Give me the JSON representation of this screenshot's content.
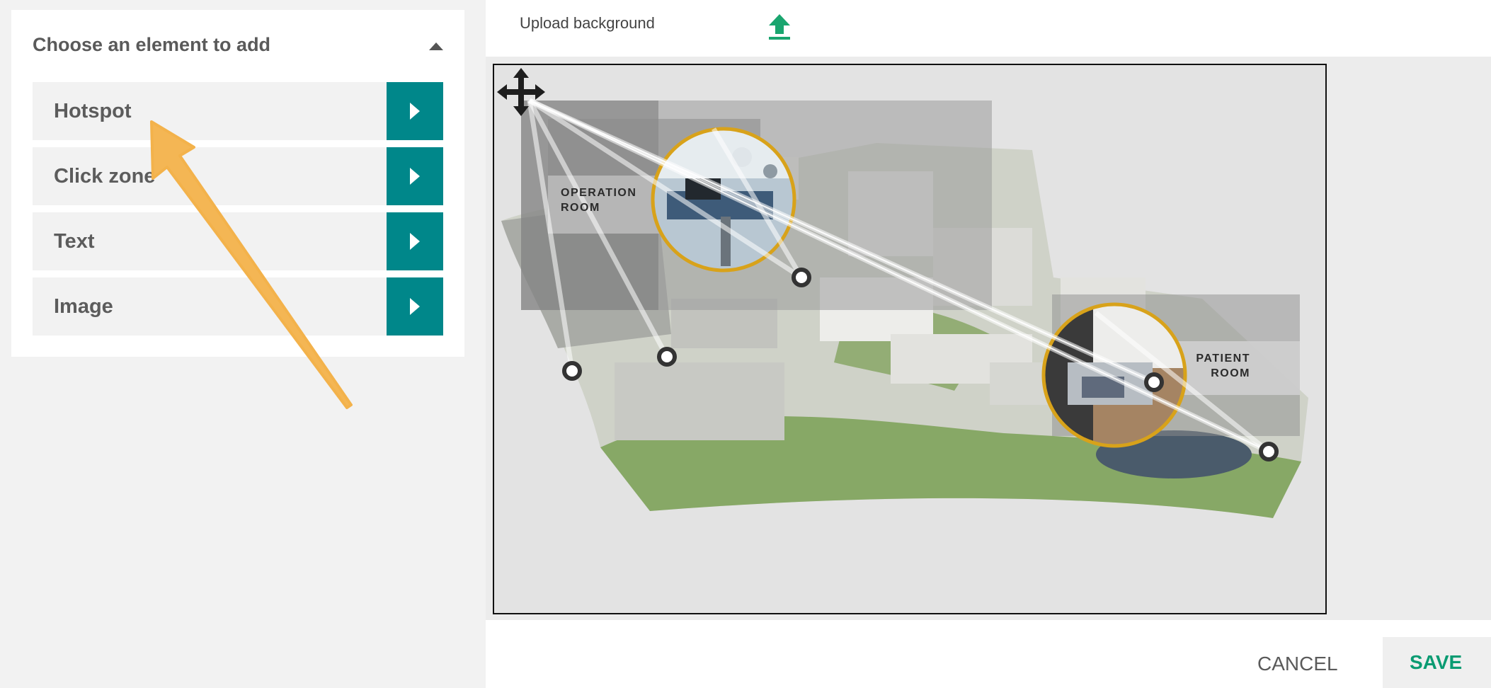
{
  "panel": {
    "title": "Choose an element to add",
    "items": [
      {
        "label": "Hotspot"
      },
      {
        "label": "Click zone"
      },
      {
        "label": "Text"
      },
      {
        "label": "Image"
      }
    ]
  },
  "upload": {
    "label": "Upload background",
    "icon": "upload-icon"
  },
  "canvas": {
    "callouts": [
      {
        "label_lines": [
          "OPERATION",
          "ROOM"
        ]
      },
      {
        "label_lines": [
          "PATIENT",
          "ROOM"
        ]
      }
    ],
    "move_icon": "move-icon"
  },
  "footer": {
    "cancel_label": "CANCEL",
    "save_label": "SAVE"
  },
  "colors": {
    "accent_teal": "#00878a",
    "save_green": "#0a9b72",
    "annotation_orange": "#f3b24b",
    "hotspot_ring": "#d8a21a"
  }
}
